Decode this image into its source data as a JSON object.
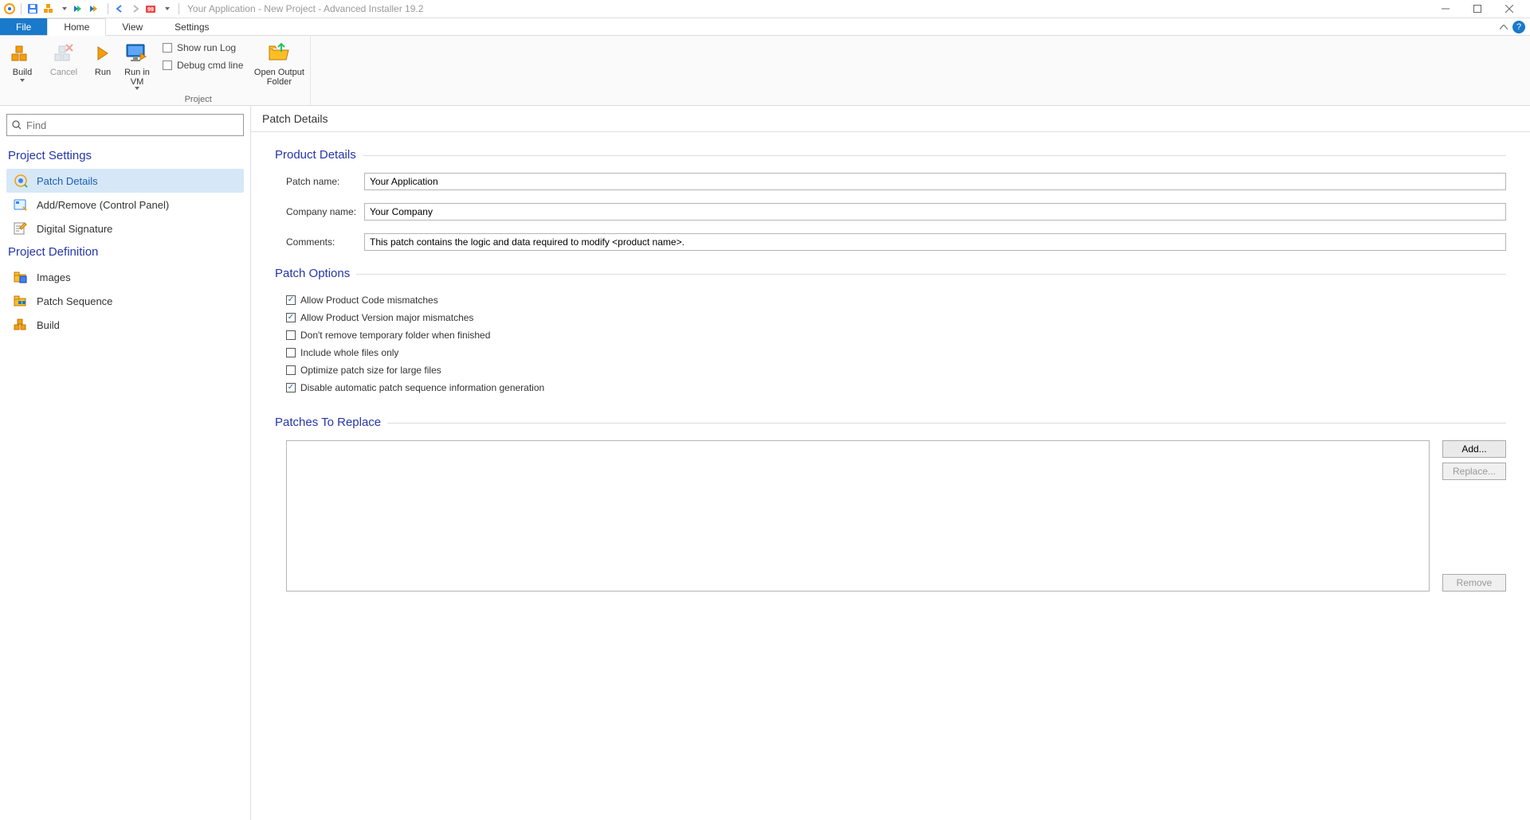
{
  "title": "Your Application - New Project - Advanced Installer 19.2",
  "menu": {
    "file": "File",
    "home": "Home",
    "view": "View",
    "settings": "Settings"
  },
  "ribbon": {
    "build": "Build",
    "cancel": "Cancel",
    "run": "Run",
    "run_in_vm": "Run in VM",
    "show_run_log": "Show run Log",
    "debug_cmd": "Debug cmd line",
    "open_output": "Open Output Folder",
    "group_project": "Project"
  },
  "search_placeholder": "Find",
  "sidebar": {
    "settings_header": "Project Settings",
    "definition_header": "Project Definition",
    "items_settings": [
      "Patch Details",
      "Add/Remove (Control Panel)",
      "Digital Signature"
    ],
    "items_definition": [
      "Images",
      "Patch Sequence",
      "Build"
    ]
  },
  "page": {
    "header": "Patch Details",
    "section_product": "Product Details",
    "labels": {
      "patch_name": "Patch name:",
      "company_name": "Company name:",
      "comments": "Comments:"
    },
    "values": {
      "patch_name": "Your Application",
      "company_name": "Your Company",
      "comments": "This patch contains the logic and data required to modify <product name>."
    },
    "section_options": "Patch Options",
    "options": [
      {
        "label": "Allow Product Code mismatches",
        "checked": true
      },
      {
        "label": "Allow Product Version major mismatches",
        "checked": true
      },
      {
        "label": "Don't remove temporary folder when finished",
        "checked": false
      },
      {
        "label": "Include whole files only",
        "checked": false
      },
      {
        "label": "Optimize patch size for large files",
        "checked": false
      },
      {
        "label": "Disable automatic patch sequence information generation",
        "checked": true
      }
    ],
    "section_replace": "Patches To Replace",
    "buttons": {
      "add": "Add...",
      "replace": "Replace...",
      "remove": "Remove"
    }
  }
}
